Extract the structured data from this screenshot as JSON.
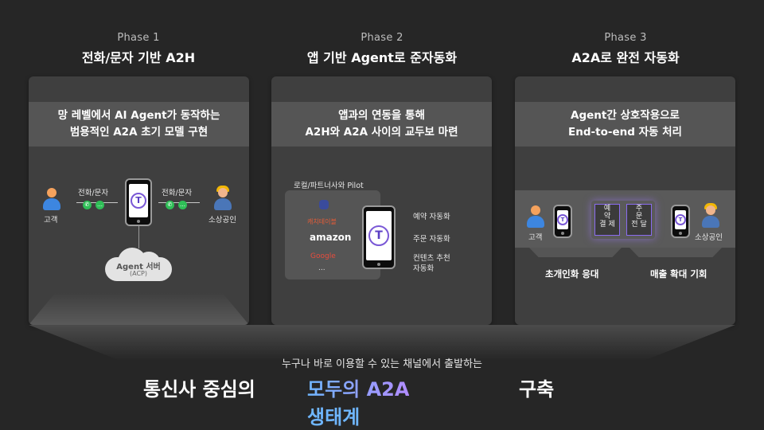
{
  "phases": [
    {
      "label": "Phase 1",
      "title": "전화/문자 기반 A2H",
      "subtitle_1": "망 레벨에서 AI Agent가 동작하는",
      "subtitle_2": "범용적인 A2A 초기 모델 구현"
    },
    {
      "label": "Phase 2",
      "title": "앱 기반 Agent로 준자동화",
      "subtitle_1": "앱과의 연동을 통해",
      "subtitle_2": "A2H와 A2A 사이의 교두보 마련"
    },
    {
      "label": "Phase 3",
      "title": "A2A로 완전 자동화",
      "subtitle_1": "Agent간 상호작용으로",
      "subtitle_2": "End-to-end 자동 처리"
    }
  ],
  "phase1": {
    "customer": "고객",
    "merchant": "소상공인",
    "comm_left": "전화/문자",
    "comm_right": "전화/문자",
    "server_title": "Agent 서버",
    "server_sub": "(ACP)"
  },
  "phase2": {
    "partners_label": "로컬/파트너사와 Pilot",
    "partners": [
      "캐치테이블",
      "amazon",
      "Google",
      "..."
    ],
    "features": [
      "예약 자동화",
      "주문 자동화",
      "컨텐츠 추천\n자동화"
    ]
  },
  "phase3": {
    "customer": "고객",
    "merchant": "소상공인",
    "left_box": [
      "예",
      "약",
      "결",
      "제"
    ],
    "right_box": [
      "주",
      "문",
      "전",
      "달"
    ],
    "benefit_left": "초개인화 응대",
    "benefit_right": "매출 확대 기회"
  },
  "footer": {
    "lead": "누구나 바로 이용할 수 있는 채널에서 출발하는",
    "part1": "통신사 중심의",
    "part2": "모두의 A2A",
    "part3": "생태계",
    "part4": "구축"
  },
  "colors": {
    "accent_blue": "#6fb6ff",
    "accent_purple": "#b18cff",
    "logo": "#5b3fc4",
    "panel": "#3f3f3f",
    "panel_header": "#555555"
  }
}
